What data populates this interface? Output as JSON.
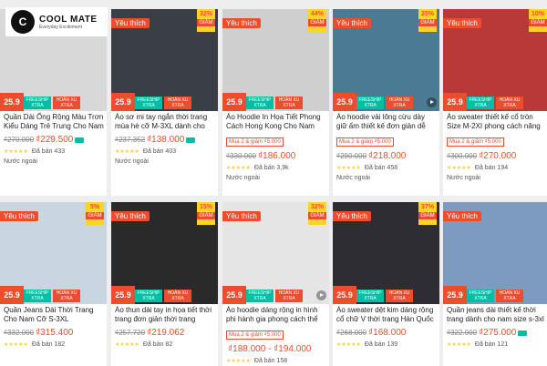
{
  "logo": {
    "mark": "C",
    "name": "COOL MATE",
    "tagline": "Everyday Excitement"
  },
  "products": [
    {
      "fav": "",
      "discount": "",
      "title": "Quần Dài Ống Rộng Màu Trơn Kiểu Dáng Trẻ Trung Cho Nam",
      "promo": "",
      "old_price": "₫270.000",
      "price": "₫229.500",
      "sold": "Đã bán 433",
      "origin": "Nước ngoài",
      "img_color": "#d8d8d8",
      "badge": "25.9",
      "freeship": "FREESHIP XTRA",
      "hoanxu": "HOÀN XU XTRA",
      "truck": true,
      "play": false
    },
    {
      "fav": "Yêu thích",
      "discount": "32%",
      "title": "Áo sơ mi tay ngắn thời trang mùa hè cỡ M-3XL dành cho n...",
      "promo": "",
      "old_price": "₫237.352",
      "price": "₫138.000",
      "sold": "Đã bán 403",
      "origin": "Nước ngoài",
      "img_color": "#3a3f46",
      "badge": "25.9",
      "freeship": "FREESHIP XTRA",
      "hoanxu": "HOÀN XU XTRA",
      "truck": true,
      "play": false
    },
    {
      "fav": "Yêu thích",
      "discount": "44%",
      "title": "Áo Hoodie In Họa Tiết Phong Cách Hong Kong Cho Nam",
      "promo": "Mua 2 & giảm ₫5.000",
      "old_price": "₫330.000",
      "price": "₫186.000",
      "sold": "Đã bán 3,9k",
      "origin": "Nước ngoài",
      "img_color": "#cfcfcf",
      "badge": "25.9",
      "freeship": "FREESHIP XTRA",
      "hoanxu": "HOÀN XU XTRA",
      "truck": false,
      "play": false
    },
    {
      "fav": "Yêu thích",
      "discount": "25%",
      "title": "Áo hoodie vải lông cừu dày giữ ấm thiết kế đơn giản dễ phối...",
      "promo": "Mua 2 & giảm ₫5.000",
      "old_price": "₫290.000",
      "price": "₫218.000",
      "sold": "Đã bán 458",
      "origin": "Nước ngoài",
      "img_color": "#4a7a94",
      "badge": "25.9",
      "freeship": "FREESHIP XTRA",
      "hoanxu": "HOÀN XU XTRA",
      "truck": false,
      "play": true
    },
    {
      "fav": "Yêu thích",
      "discount": "10%",
      "title": "Áo sweater thiết kế cổ tròn Size M-2XI phong cách năng động...",
      "promo": "Mua 2 & giảm ₫5.000",
      "old_price": "₫300.000",
      "price": "₫270.000",
      "sold": "Đã bán 194",
      "origin": "Nước ngoài",
      "img_color": "#b93838",
      "badge": "25.9",
      "freeship": "FREESHIP XTRA",
      "hoanxu": "HOÀN XU XTRA",
      "truck": false,
      "play": false
    },
    {
      "fav": "Yêu thích",
      "discount": "5%",
      "title": "Quần Jeans Dài Thời Trang Cho Nam Cỡ S-3XL",
      "promo": "",
      "old_price": "₫332.000",
      "price": "₫315.400",
      "sold": "Đã bán 182",
      "origin": "",
      "img_color": "#c9d6e2",
      "badge": "25.9",
      "freeship": "FREESHIP XTRA",
      "hoanxu": "HOÀN XU XTRA",
      "truck": false,
      "play": false
    },
    {
      "fav": "Yêu thích",
      "discount": "15%",
      "title": "Áo thun dài tay in họa tiết thời trang đơn giản thời trang cho...",
      "promo": "",
      "old_price": "₫257.720",
      "price": "₫219.062",
      "sold": "Đã bán 82",
      "origin": "",
      "img_color": "#2a2a2a",
      "badge": "25.9",
      "freeship": "FREESHIP XTRA",
      "hoanxu": "HOÀN XU XTRA",
      "truck": false,
      "play": false
    },
    {
      "fav": "Yêu thích",
      "discount": "32%",
      "title": "Áo hoodie dáng rộng in hình phi hành gia phong cách thể thao...",
      "promo": "Mua 2 & giảm ₫5.000",
      "old_price": "",
      "price": "₫188.000 - ₫194.000",
      "sold": "Đã bán 158",
      "origin": "",
      "img_color": "#e5e5e5",
      "badge": "25.9",
      "freeship": "FREESHIP XTRA",
      "hoanxu": "HOÀN XU XTRA",
      "truck": false,
      "play": true
    },
    {
      "fav": "Yêu thích",
      "discount": "37%",
      "title": "Áo sweater dệt kim dáng rộng cổ chữ V thời trang Hàn Quốc siz...",
      "promo": "",
      "old_price": "₫268.000",
      "price": "₫168.000",
      "sold": "Đã bán 139",
      "origin": "",
      "img_color": "#2d2d33",
      "badge": "25.9",
      "freeship": "FREESHIP XTRA",
      "hoanxu": "HOÀN XU XTRA",
      "truck": false,
      "play": false
    },
    {
      "fav": "Yêu thích",
      "discount": "",
      "title": "Quần jeans dài thiết kế thời trang dành cho nam size s-3xl",
      "promo": "",
      "old_price": "₫322.000",
      "price": "₫275.000",
      "sold": "Đã bán 121",
      "origin": "",
      "img_color": "#7d9bc0",
      "badge": "25.9",
      "freeship": "FREESHIP XTRA",
      "hoanxu": "HOÀN XU XTRA",
      "truck": true,
      "play": false
    }
  ]
}
